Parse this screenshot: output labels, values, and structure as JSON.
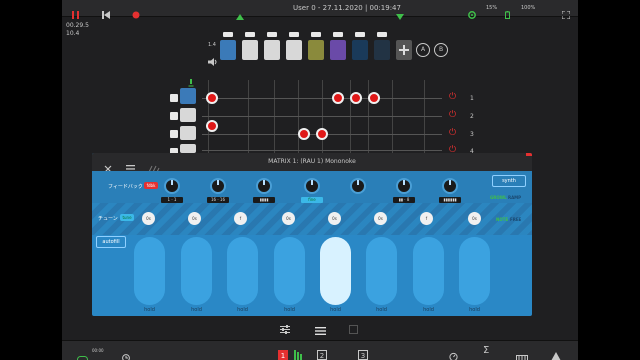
{
  "colors": {
    "accent": "#e53030",
    "panel": "#2a88c6",
    "active_pill": "#d8f2ff"
  },
  "topbar": {
    "title": "User 0 - 27.11.2020 | 00:19:47",
    "cpu": "15%",
    "battery": "100%",
    "icons": [
      "pause-icon",
      "rewind-icon",
      "record-icon",
      "arrow-up-icon",
      "arrow-down-icon",
      "gear-icon",
      "battery-icon",
      "fullscreen-icon"
    ]
  },
  "left_info": {
    "line1": "00.29.5",
    "line2": "10.4"
  },
  "matrix": {
    "row_numbers": [
      "1",
      "2",
      "3",
      "4"
    ],
    "send_labels": [
      "A",
      "B"
    ],
    "header_label": "1.4"
  },
  "panel": {
    "title": "MATRIX 1: (RAU 1) Mononoke",
    "synth_label": "synth",
    "feedback_label": "フィードバック",
    "feedback_badge": "fdbk",
    "tune_label": "チューン",
    "tune_badge": "tune",
    "growl_label": "GROWL",
    "ramp_label": "RAMP",
    "note_label": "NOTE",
    "free_label": "FREE",
    "autofill_label": "autofill",
    "knob_values": [
      "1 · 1",
      "16 · 16",
      "▮▮▮▮",
      "",
      "fine",
      "▮▮ · 8",
      "▮▮▮▮",
      "▮▮▮▮▮▮"
    ],
    "tune_values": [
      "0s",
      "0s",
      "f",
      "0s",
      "0s",
      "0s",
      "f",
      "0s"
    ],
    "pills": [
      "hold",
      "hold",
      "hold",
      "hold",
      "hold",
      "hold",
      "hold",
      "hold"
    ],
    "active_pill_index": 4
  },
  "bottombar": {
    "left_text": "00:00",
    "icons": [
      "loop-icon",
      "clock-icon",
      "matrix-1-icon",
      "matrix-2-icon",
      "matrix-3-icon",
      "tuner-icon",
      "sigma-icon",
      "piano-icon",
      "alert-icon"
    ]
  }
}
